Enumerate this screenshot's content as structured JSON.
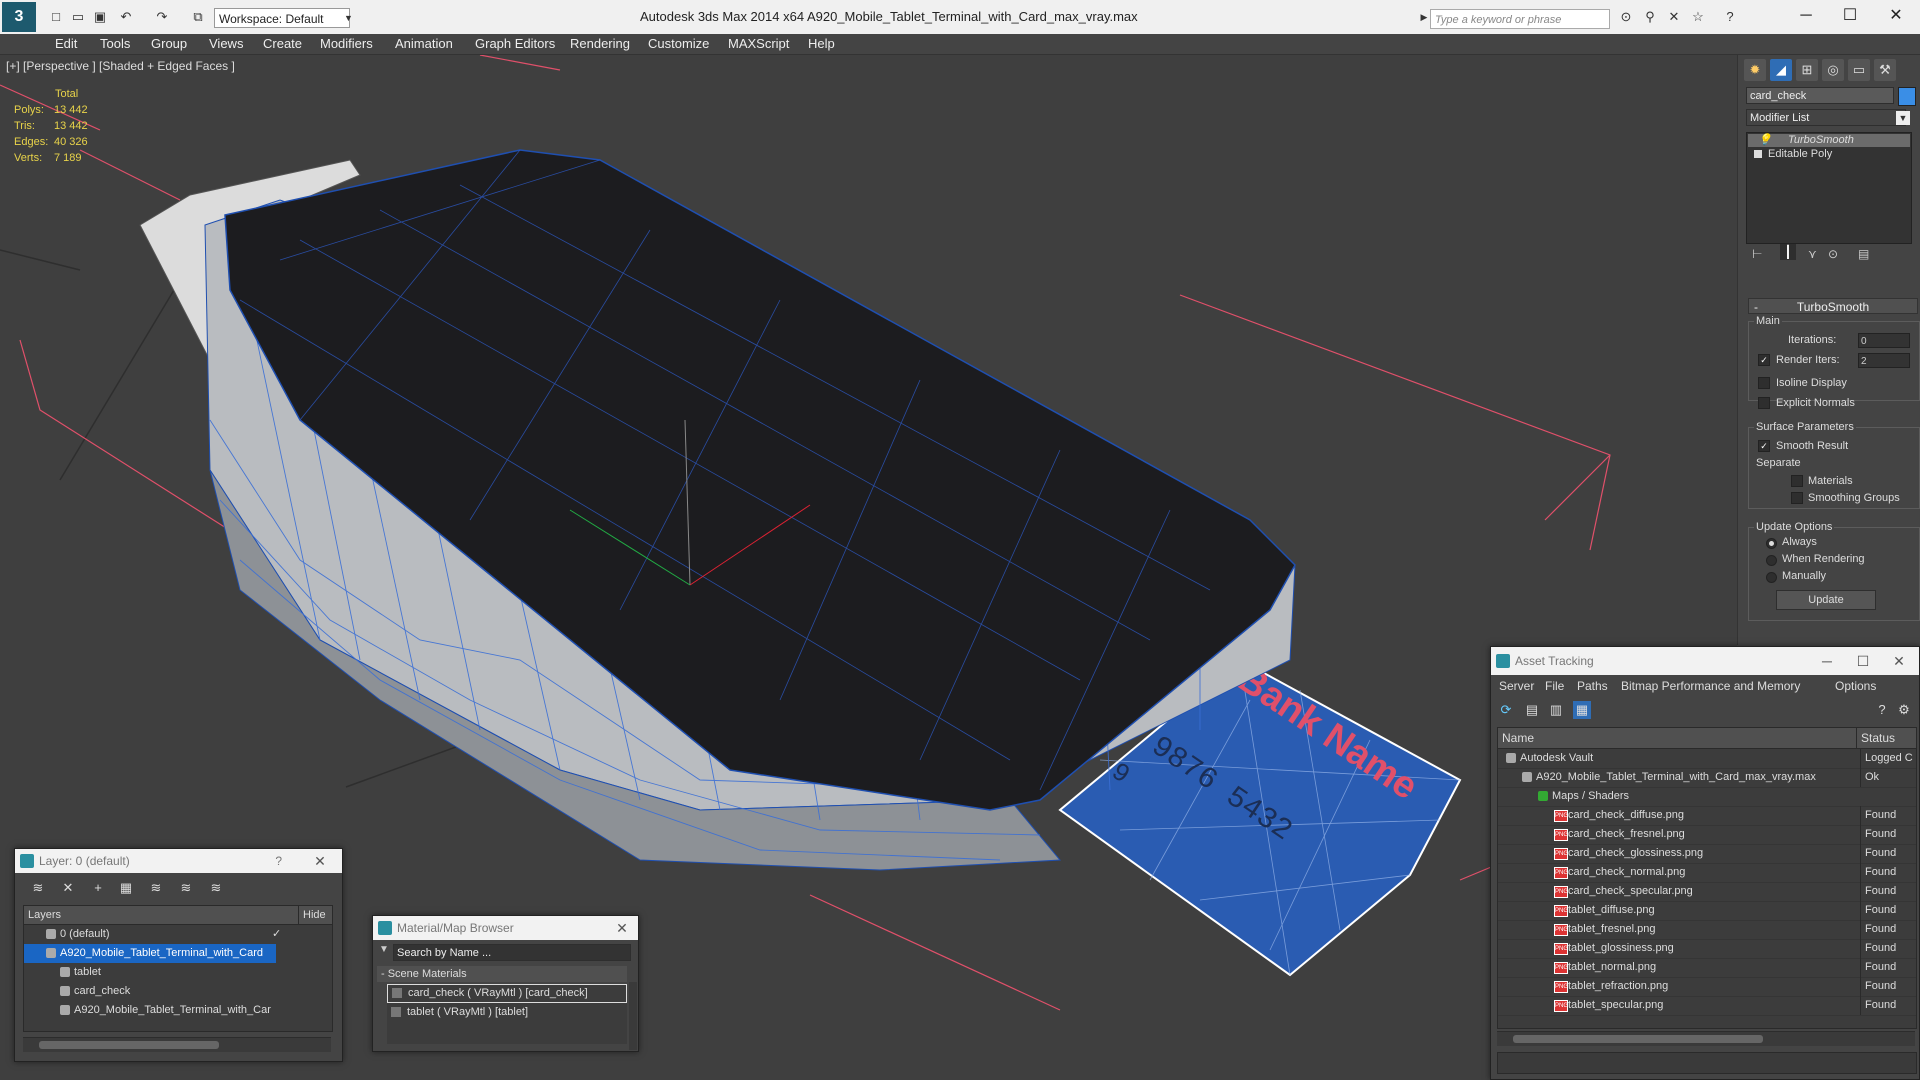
{
  "app": {
    "title": "Autodesk 3ds Max  2014 x64      A920_Mobile_Tablet_Terminal_with_Card_max_vray.max",
    "workspace": "Workspace: Default",
    "search_placeholder": "Type a keyword or phrase"
  },
  "menu": [
    "Edit",
    "Tools",
    "Group",
    "Views",
    "Create",
    "Modifiers",
    "Animation",
    "Graph Editors",
    "Rendering",
    "Customize",
    "MAXScript",
    "Help"
  ],
  "viewport": {
    "label": "[+] [Perspective ] [Shaded + Edged Faces ]",
    "stats": {
      "header": "Total",
      "rows": [
        {
          "label": "Polys:",
          "value": "13 442"
        },
        {
          "label": "Tris:",
          "value": "13 442"
        },
        {
          "label": "Edges:",
          "value": "40 326"
        },
        {
          "label": "Verts:",
          "value": "7 189"
        }
      ]
    },
    "card_text": {
      "bank": "Bank Name",
      "number_1": "9876 5432",
      "number_2": "9"
    }
  },
  "command_panel": {
    "object_name": "card_check",
    "modifier_list": "Modifier List",
    "stack": [
      "TurboSmooth",
      "Editable Poly"
    ],
    "rollout": "TurboSmooth",
    "main_label": "Main",
    "iterations_label": "Iterations:",
    "iterations_value": "0",
    "render_iters_label": "Render Iters:",
    "render_iters_value": "2",
    "isoline": "Isoline Display",
    "explicit_normals": "Explicit Normals",
    "surface_params": "Surface Parameters",
    "smooth_result": "Smooth Result",
    "separate": "Separate",
    "materials": "Materials",
    "smoothing_groups": "Smoothing Groups",
    "update_options": "Update Options",
    "always": "Always",
    "when_rendering": "When Rendering",
    "manually": "Manually",
    "update_button": "Update"
  },
  "layer_window": {
    "title": "Layer: 0 (default)",
    "help": "?",
    "col_layers": "Layers",
    "col_hide": "Hide",
    "rows": [
      "0 (default)",
      "A920_Mobile_Tablet_Terminal_with_Card",
      "tablet",
      "card_check",
      "A920_Mobile_Tablet_Terminal_with_Car"
    ]
  },
  "material_browser": {
    "title": "Material/Map Browser",
    "search_placeholder": "Search by Name ...",
    "section": "- Scene Materials",
    "items": [
      "card_check  ( VRayMtl )  [card_check]",
      "tablet  ( VRayMtl )  [tablet]"
    ]
  },
  "asset_tracking": {
    "title": "Asset Tracking",
    "menu": [
      "Server",
      "File",
      "Paths",
      "Bitmap Performance and Memory",
      "Options"
    ],
    "col_name": "Name",
    "col_status": "Status",
    "rows": [
      {
        "name": "Autodesk Vault",
        "status": "Logged C"
      },
      {
        "name": "A920_Mobile_Tablet_Terminal_with_Card_max_vray.max",
        "status": "Ok"
      },
      {
        "name": "Maps / Shaders",
        "status": ""
      },
      {
        "name": "card_check_diffuse.png",
        "status": "Found"
      },
      {
        "name": "card_check_fresnel.png",
        "status": "Found"
      },
      {
        "name": "card_check_glossiness.png",
        "status": "Found"
      },
      {
        "name": "card_check_normal.png",
        "status": "Found"
      },
      {
        "name": "card_check_specular.png",
        "status": "Found"
      },
      {
        "name": "tablet_diffuse.png",
        "status": "Found"
      },
      {
        "name": "tablet_fresnel.png",
        "status": "Found"
      },
      {
        "name": "tablet_glossiness.png",
        "status": "Found"
      },
      {
        "name": "tablet_normal.png",
        "status": "Found"
      },
      {
        "name": "tablet_refraction.png",
        "status": "Found"
      },
      {
        "name": "tablet_specular.png",
        "status": "Found"
      }
    ]
  },
  "colors": {
    "selection": "#1a66c4",
    "wire": "#3b6fd6",
    "stats": "#e8d34a",
    "bbox": "#e0506a"
  }
}
